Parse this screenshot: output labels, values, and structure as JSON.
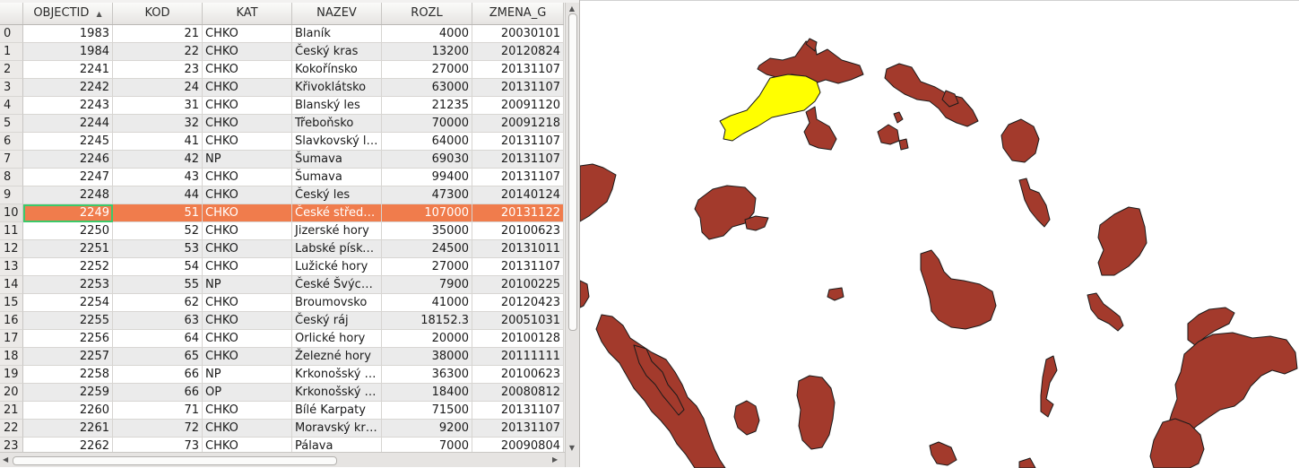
{
  "table": {
    "sort_indicator": "▲",
    "columns": [
      {
        "key": "objectid",
        "label": "OBJECTID"
      },
      {
        "key": "kod",
        "label": "KOD"
      },
      {
        "key": "kat",
        "label": "KAT"
      },
      {
        "key": "nazev",
        "label": "NAZEV"
      },
      {
        "key": "rozl",
        "label": "ROZL"
      },
      {
        "key": "zmena_g",
        "label": "ZMENA_G"
      }
    ],
    "rows": [
      {
        "idx": "0",
        "objectid": "1983",
        "kod": "21",
        "kat": "CHKO",
        "nazev": "Blaník",
        "rozl": "4000",
        "zmena_g": "20030101"
      },
      {
        "idx": "1",
        "objectid": "1984",
        "kod": "22",
        "kat": "CHKO",
        "nazev": "Český kras",
        "rozl": "13200",
        "zmena_g": "20120824"
      },
      {
        "idx": "2",
        "objectid": "2241",
        "kod": "23",
        "kat": "CHKO",
        "nazev": "Kokořínsko",
        "rozl": "27000",
        "zmena_g": "20131107"
      },
      {
        "idx": "3",
        "objectid": "2242",
        "kod": "24",
        "kat": "CHKO",
        "nazev": "Křivoklátsko",
        "rozl": "63000",
        "zmena_g": "20131107"
      },
      {
        "idx": "4",
        "objectid": "2243",
        "kod": "31",
        "kat": "CHKO",
        "nazev": "Blanský les",
        "rozl": "21235",
        "zmena_g": "20091120"
      },
      {
        "idx": "5",
        "objectid": "2244",
        "kod": "32",
        "kat": "CHKO",
        "nazev": "Třeboňsko",
        "rozl": "70000",
        "zmena_g": "20091218"
      },
      {
        "idx": "6",
        "objectid": "2245",
        "kod": "41",
        "kat": "CHKO",
        "nazev": "Slavkovský les",
        "rozl": "64000",
        "zmena_g": "20131107"
      },
      {
        "idx": "7",
        "objectid": "2246",
        "kod": "42",
        "kat": "NP",
        "nazev": "Šumava",
        "rozl": "69030",
        "zmena_g": "20131107"
      },
      {
        "idx": "8",
        "objectid": "2247",
        "kod": "43",
        "kat": "CHKO",
        "nazev": "Šumava",
        "rozl": "99400",
        "zmena_g": "20131107"
      },
      {
        "idx": "9",
        "objectid": "2248",
        "kod": "44",
        "kat": "CHKO",
        "nazev": "Český les",
        "rozl": "47300",
        "zmena_g": "20140124"
      },
      {
        "idx": "10",
        "objectid": "2249",
        "kod": "51",
        "kat": "CHKO",
        "nazev": "České středohoří",
        "rozl": "107000",
        "zmena_g": "20131122"
      },
      {
        "idx": "11",
        "objectid": "2250",
        "kod": "52",
        "kat": "CHKO",
        "nazev": "Jizerské hory",
        "rozl": "35000",
        "zmena_g": "20100623"
      },
      {
        "idx": "12",
        "objectid": "2251",
        "kod": "53",
        "kat": "CHKO",
        "nazev": "Labské pískovce",
        "rozl": "24500",
        "zmena_g": "20131011"
      },
      {
        "idx": "13",
        "objectid": "2252",
        "kod": "54",
        "kat": "CHKO",
        "nazev": "Lužické hory",
        "rozl": "27000",
        "zmena_g": "20131107"
      },
      {
        "idx": "14",
        "objectid": "2253",
        "kod": "55",
        "kat": "NP",
        "nazev": "České Švýcarsko",
        "rozl": "7900",
        "zmena_g": "20100225"
      },
      {
        "idx": "15",
        "objectid": "2254",
        "kod": "62",
        "kat": "CHKO",
        "nazev": "Broumovsko",
        "rozl": "41000",
        "zmena_g": "20120423"
      },
      {
        "idx": "16",
        "objectid": "2255",
        "kod": "63",
        "kat": "CHKO",
        "nazev": "Český ráj",
        "rozl": "18152.3",
        "zmena_g": "20051031"
      },
      {
        "idx": "17",
        "objectid": "2256",
        "kod": "64",
        "kat": "CHKO",
        "nazev": "Orlické hory",
        "rozl": "20000",
        "zmena_g": "20100128"
      },
      {
        "idx": "18",
        "objectid": "2257",
        "kod": "65",
        "kat": "CHKO",
        "nazev": "Železné hory",
        "rozl": "38000",
        "zmena_g": "20111111"
      },
      {
        "idx": "19",
        "objectid": "2258",
        "kod": "66",
        "kat": "NP",
        "nazev": "Krkonošský národní park",
        "rozl": "36300",
        "zmena_g": "20100623"
      },
      {
        "idx": "20",
        "objectid": "2259",
        "kod": "66",
        "kat": "OP",
        "nazev": "Krkonošský národní park",
        "rozl": "18400",
        "zmena_g": "20080812"
      },
      {
        "idx": "21",
        "objectid": "2260",
        "kod": "71",
        "kat": "CHKO",
        "nazev": "Bílé Karpaty",
        "rozl": "71500",
        "zmena_g": "20131107"
      },
      {
        "idx": "22",
        "objectid": "2261",
        "kod": "72",
        "kat": "CHKO",
        "nazev": "Moravský kras",
        "rozl": "9200",
        "zmena_g": "20131107"
      },
      {
        "idx": "23",
        "objectid": "2262",
        "kod": "73",
        "kat": "CHKO",
        "nazev": "Pálava",
        "rozl": "7000",
        "zmena_g": "20090804"
      }
    ],
    "selected_row": 10,
    "colors": {
      "selection": "#f07c4c",
      "focus_border": "#3cc96a"
    }
  },
  "map": {
    "feature_color": "#a33a2c",
    "selected_feature_color": "#ffff00",
    "outline_color": "#1a1a1a"
  }
}
